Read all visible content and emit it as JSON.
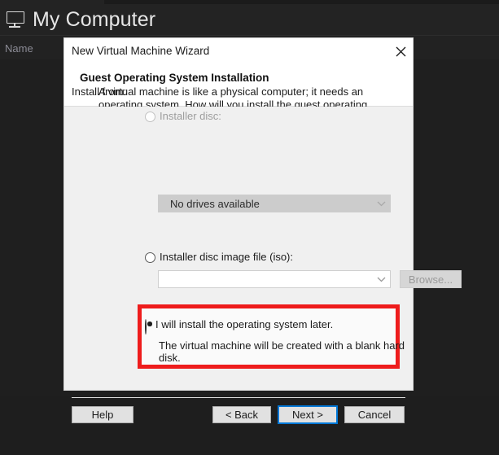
{
  "background_app": {
    "title": "My Computer",
    "title_icon": "monitor-icon",
    "column_header": "Name"
  },
  "dialog": {
    "titlebar": {
      "title": "New Virtual Machine Wizard",
      "close_icon": "close-icon"
    },
    "header": {
      "heading": "Guest Operating System Installation",
      "description": "A virtual machine is like a physical computer; it needs an operating system. How will you install the guest operating system?"
    },
    "body": {
      "group_label": "Install from:",
      "options": [
        {
          "id": "installer-disc",
          "label": "Installer disc:",
          "selected": false,
          "disabled": true,
          "combo": {
            "value": "No drives available",
            "placeholder": "",
            "disabled": true,
            "arrow_icon": "chevron-down-icon"
          }
        },
        {
          "id": "installer-iso",
          "label": "Installer disc image file (iso):",
          "selected": false,
          "disabled": false,
          "combo": {
            "value": "",
            "placeholder": "",
            "disabled": false,
            "arrow_icon": "chevron-down-icon"
          },
          "browse_button": {
            "label": "Browse...",
            "disabled": true
          }
        },
        {
          "id": "install-later",
          "label": "I will install the operating system later.",
          "description": "The virtual machine will be created with a blank hard disk.",
          "selected": true,
          "disabled": false,
          "highlighted": true
        }
      ]
    },
    "footer": {
      "help": "Help",
      "back": "< Back",
      "next": "Next >",
      "cancel": "Cancel"
    }
  },
  "colors": {
    "annotation_red": "#ee1c1c",
    "default_button_border": "#0078d7",
    "dialog_bg": "#f0f0f0",
    "app_bg": "#1f1f1f"
  }
}
